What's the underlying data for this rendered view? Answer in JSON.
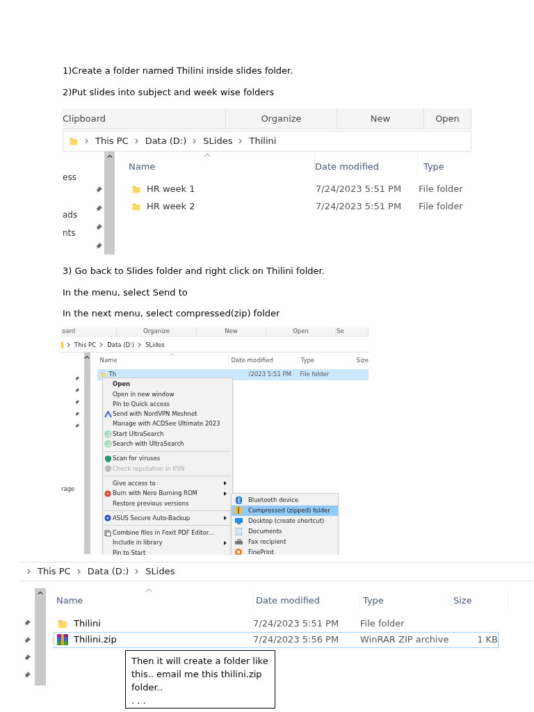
{
  "steps_top": [
    "1)Create a folder named Thilini inside slides folder.",
    "2)Put slides into subject and week wise folders"
  ],
  "screenshot_1": {
    "ribbon": [
      "Clipboard",
      "Organize",
      "New",
      "Open"
    ],
    "breadcrumb": [
      "This PC",
      "Data (D:)",
      "SLides",
      "Thilini"
    ],
    "nav_fragments": [
      "ess",
      "ads",
      "nts"
    ],
    "columns": [
      "Name",
      "Date modified",
      "Type"
    ],
    "rows": [
      {
        "name": "HR week 1",
        "date": "7/24/2023 5:51 PM",
        "type": "File folder"
      },
      {
        "name": "HR week 2",
        "date": "7/24/2023 5:51 PM",
        "type": "File folder"
      }
    ]
  },
  "steps_middle": [
    "3) Go back to Slides folder and right click on Thilini folder.",
    "In the menu, select Send to",
    "In the next menu, select compressed(zip) folder"
  ],
  "screenshot_2": {
    "ribbon": [
      "oard",
      "Organize",
      "New",
      "Open",
      "Se"
    ],
    "breadcrumb": [
      "This PC",
      "Data (D:)",
      "SLides"
    ],
    "nav_fragments": [
      "rage"
    ],
    "columns": [
      "Name",
      "Date modified",
      "Type",
      "Size"
    ],
    "rows": [
      {
        "name": "Th",
        "date": "/2023 5:51 PM",
        "type": "File folder",
        "selected": true
      }
    ],
    "context_menu": [
      {
        "kind": "item",
        "label": "Open",
        "bold": true,
        "disabled": false,
        "submenu": false
      },
      {
        "kind": "item",
        "label": "Open in new window",
        "bold": false,
        "disabled": false,
        "submenu": false
      },
      {
        "kind": "item",
        "label": "Pin to Quick access",
        "bold": false,
        "disabled": false,
        "submenu": false
      },
      {
        "kind": "item",
        "label": "Send with NordVPN Meshnet",
        "bold": false,
        "disabled": false,
        "submenu": false
      },
      {
        "kind": "item",
        "label": "Manage with ACDSee Ultimate 2023",
        "bold": false,
        "disabled": false,
        "submenu": false
      },
      {
        "kind": "item",
        "label": "Start UltraSearch",
        "bold": false,
        "disabled": false,
        "submenu": false
      },
      {
        "kind": "item",
        "label": "Search with UltraSearch",
        "bold": false,
        "disabled": false,
        "submenu": false
      },
      {
        "kind": "separator"
      },
      {
        "kind": "item",
        "label": "Scan for viruses",
        "bold": false,
        "disabled": false,
        "submenu": false
      },
      {
        "kind": "item",
        "label": "Check reputation in KSN",
        "bold": false,
        "disabled": true,
        "submenu": false
      },
      {
        "kind": "separator"
      },
      {
        "kind": "item",
        "label": "Give access to",
        "bold": false,
        "disabled": false,
        "submenu": true
      },
      {
        "kind": "item",
        "label": "Burn with Nero Burning ROM",
        "bold": false,
        "disabled": false,
        "submenu": true
      },
      {
        "kind": "item",
        "label": "Restore previous versions",
        "bold": false,
        "disabled": false,
        "submenu": false
      },
      {
        "kind": "separator"
      },
      {
        "kind": "item",
        "label": "ASUS Secure Auto-Backup",
        "bold": false,
        "disabled": false,
        "submenu": true
      },
      {
        "kind": "separator"
      },
      {
        "kind": "item",
        "label": "Combine files in Foxit PDF Editor...",
        "bold": false,
        "disabled": false,
        "submenu": false
      },
      {
        "kind": "item",
        "label": "Include in library",
        "bold": false,
        "disabled": false,
        "submenu": true
      },
      {
        "kind": "item",
        "label": "Pin to Start",
        "bold": false,
        "disabled": false,
        "submenu": false
      }
    ],
    "send_to_menu": [
      {
        "label": "Bluetooth device",
        "selected": false
      },
      {
        "label": "Compressed (zipped) folder",
        "selected": true
      },
      {
        "label": "Desktop (create shortcut)",
        "selected": false
      },
      {
        "label": "Documents",
        "selected": false
      },
      {
        "label": "Fax recipient",
        "selected": false
      },
      {
        "label": "FinePrint",
        "selected": false
      }
    ]
  },
  "screenshot_3": {
    "breadcrumb": [
      "This PC",
      "Data (D:)",
      "SLides"
    ],
    "columns": [
      "Name",
      "Date modified",
      "Type",
      "Size"
    ],
    "rows": [
      {
        "kind": "folder",
        "name": "Thilini",
        "date": "7/24/2023 5:51 PM",
        "type": "File folder",
        "selected": false
      },
      {
        "kind": "archive",
        "name": "Thilini.zip",
        "date": "7/24/2023 5:56 PM",
        "type": "WinRAR ZIP archive",
        "size": "1 KB",
        "selected": true
      }
    ],
    "note": [
      "Then it will create a folder like this.. email me this thilini.zip folder..",
      ". .    ."
    ]
  }
}
